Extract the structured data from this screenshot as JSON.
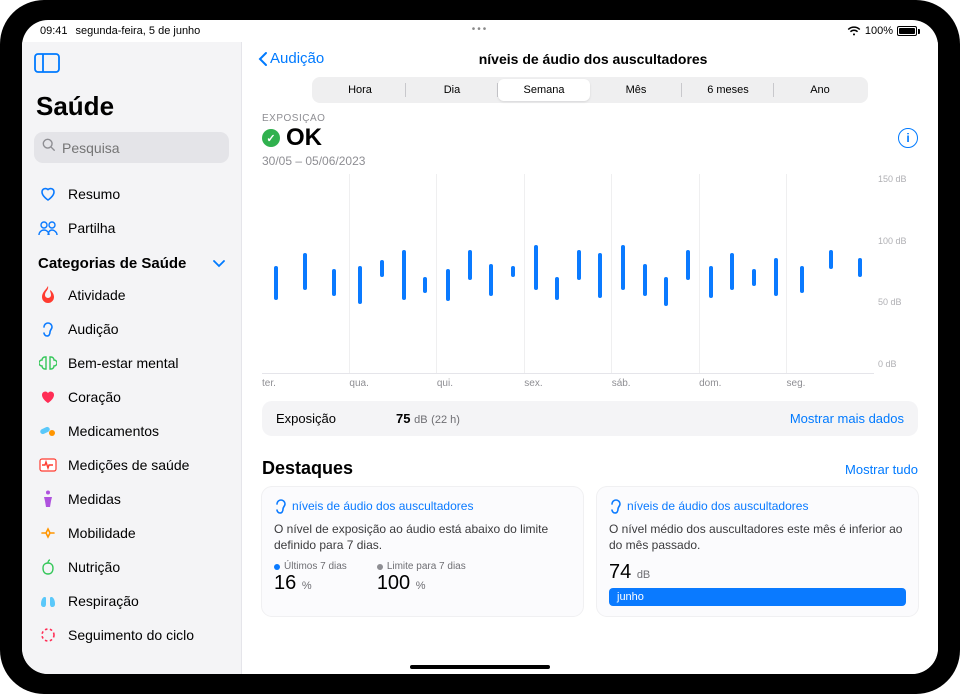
{
  "statusbar": {
    "time": "09:41",
    "date": "segunda-feira, 5 de junho",
    "battery": "100%"
  },
  "sidebar": {
    "app_title": "Saúde",
    "search_placeholder": "Pesquisa",
    "nav": [
      {
        "label": "Resumo",
        "icon": "heart-outline",
        "color": "#0a7aff"
      },
      {
        "label": "Partilha",
        "icon": "people-outline",
        "color": "#0a7aff"
      }
    ],
    "categories_header": "Categorias de Saúde",
    "categories": [
      {
        "label": "Atividade",
        "icon": "flame",
        "color": "#ff3b30"
      },
      {
        "label": "Audição",
        "icon": "ear",
        "color": "#0a7aff"
      },
      {
        "label": "Bem-estar mental",
        "icon": "brain",
        "color": "#34c759"
      },
      {
        "label": "Coração",
        "icon": "heart",
        "color": "#ff2d55"
      },
      {
        "label": "Medicamentos",
        "icon": "pills",
        "color": "#5ac8fa"
      },
      {
        "label": "Medições de saúde",
        "icon": "vitals",
        "color": "#ff3b30"
      },
      {
        "label": "Medidas",
        "icon": "body",
        "color": "#af52de"
      },
      {
        "label": "Mobilidade",
        "icon": "walk",
        "color": "#ff9500"
      },
      {
        "label": "Nutrição",
        "icon": "apple",
        "color": "#34c759"
      },
      {
        "label": "Respiração",
        "icon": "lungs",
        "color": "#5ac8fa"
      },
      {
        "label": "Seguimento do ciclo",
        "icon": "cycle",
        "color": "#ff2d55"
      }
    ]
  },
  "header": {
    "back_label": "Audição",
    "title": "níveis de áudio dos auscultadores"
  },
  "segments": [
    "Hora",
    "Dia",
    "Semana",
    "Mês",
    "6 meses",
    "Ano"
  ],
  "selected_segment": 2,
  "exposure": {
    "label": "EXPOSIÇÃO",
    "status": "OK",
    "date_range": "30/05 – 05/06/2023"
  },
  "chart_data": {
    "type": "range-bar",
    "ylabel_unit": "dB",
    "ylim": [
      0,
      150
    ],
    "yticks": [
      0,
      50,
      100,
      150
    ],
    "categories": [
      "ter.",
      "qua.",
      "qui.",
      "sex.",
      "sáb.",
      "dom.",
      "seg."
    ],
    "series": [
      {
        "day": 0,
        "bars": [
          [
            55,
            80
          ],
          [
            62,
            90
          ],
          [
            58,
            78
          ]
        ]
      },
      {
        "day": 1,
        "bars": [
          [
            52,
            80
          ],
          [
            72,
            85
          ],
          [
            55,
            92
          ],
          [
            60,
            72
          ]
        ]
      },
      {
        "day": 2,
        "bars": [
          [
            54,
            78
          ],
          [
            70,
            92
          ],
          [
            58,
            82
          ],
          [
            72,
            80
          ]
        ]
      },
      {
        "day": 3,
        "bars": [
          [
            62,
            96
          ],
          [
            55,
            72
          ],
          [
            70,
            92
          ],
          [
            56,
            90
          ]
        ]
      },
      {
        "day": 4,
        "bars": [
          [
            62,
            96
          ],
          [
            58,
            82
          ],
          [
            50,
            72
          ],
          [
            70,
            92
          ]
        ]
      },
      {
        "day": 5,
        "bars": [
          [
            56,
            80
          ],
          [
            62,
            90
          ],
          [
            65,
            78
          ],
          [
            58,
            86
          ]
        ]
      },
      {
        "day": 6,
        "bars": [
          [
            60,
            80
          ],
          [
            78,
            92
          ],
          [
            72,
            86
          ]
        ]
      }
    ]
  },
  "summary": {
    "label": "Exposição",
    "value": "75",
    "unit": "dB",
    "duration": "(22 h)",
    "show_more": "Mostrar mais dados"
  },
  "highlights": {
    "title": "Destaques",
    "show_all": "Mostrar tudo",
    "cards": [
      {
        "title": "níveis de áudio dos auscultadores",
        "desc": "O nível de exposição ao áudio está abaixo do limite definido para 7 dias.",
        "stats": [
          {
            "label": "Últimos 7 dias",
            "value": "16",
            "unit": "%",
            "dot": "blue"
          },
          {
            "label": "Limite para 7 dias",
            "value": "100",
            "unit": "%",
            "dot": "gray"
          }
        ]
      },
      {
        "title": "níveis de áudio dos auscultadores",
        "desc": "O nível médio dos auscultadores este mês é inferior ao do mês passado.",
        "big_value": "74",
        "big_unit": "dB",
        "month_bar": "junho"
      }
    ]
  }
}
